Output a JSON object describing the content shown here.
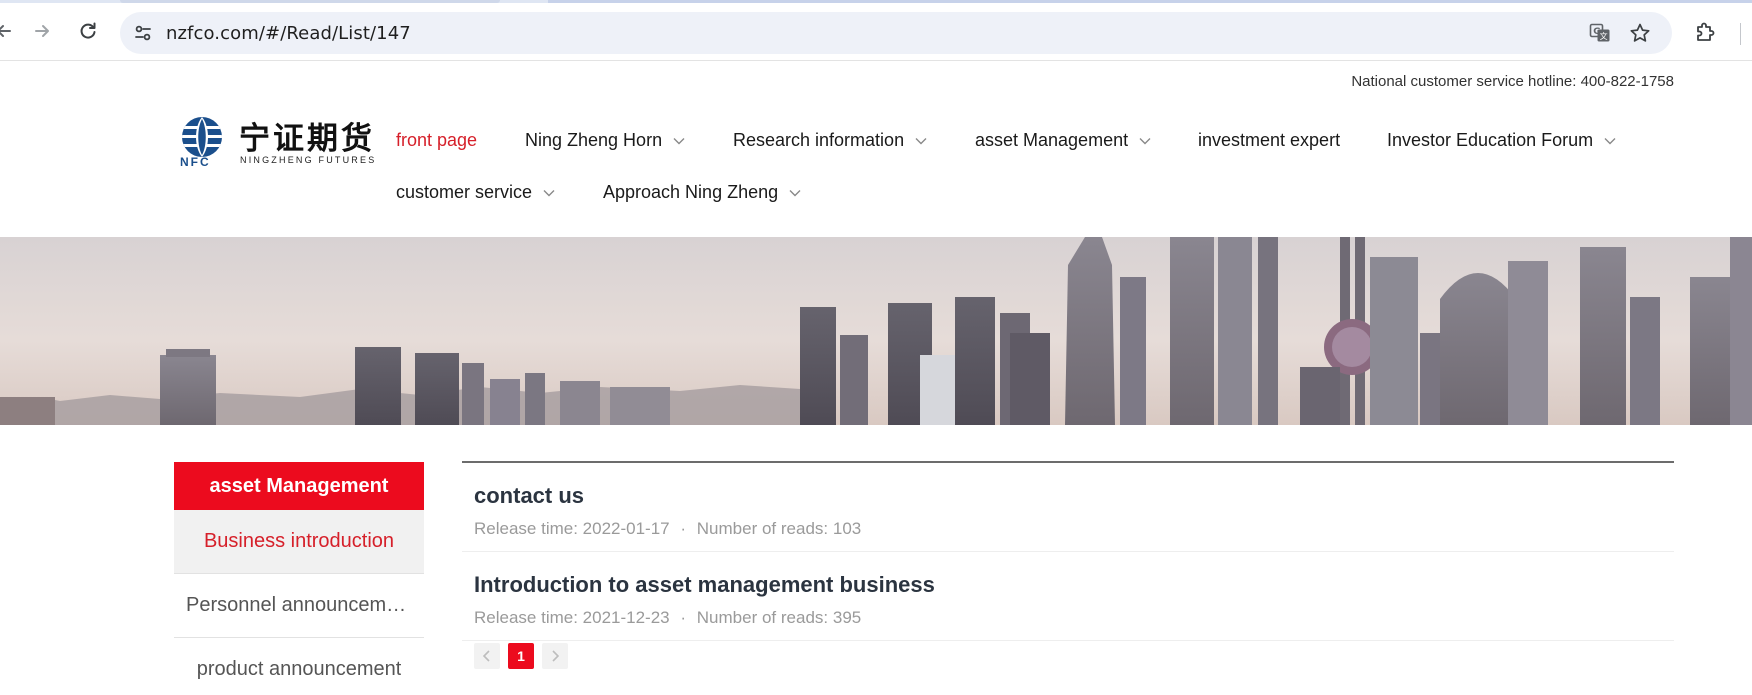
{
  "browser": {
    "url": "nzfco.com/#/Read/List/147",
    "icons": {
      "back": "arrow-left-icon",
      "forward": "arrow-right-icon",
      "reload": "reload-icon",
      "site_info": "tune-icon",
      "translate": "translate-icon",
      "bookmark": "star-icon",
      "extensions": "puzzle-icon"
    }
  },
  "header": {
    "hotline": "National customer service hotline: 400-822-1758",
    "logo": {
      "cn": "宁证期货",
      "en": "NINGZHENG  FUTURES",
      "mark_text": "NFC",
      "brand_color": "#1b4f8c"
    },
    "nav": [
      {
        "label": "front page",
        "active": true,
        "dropdown": false
      },
      {
        "label": "Ning Zheng Horn",
        "active": false,
        "dropdown": true
      },
      {
        "label": "Research information",
        "active": false,
        "dropdown": true
      },
      {
        "label": "asset Management",
        "active": false,
        "dropdown": true
      },
      {
        "label": "investment expert",
        "active": false,
        "dropdown": false
      },
      {
        "label": "Investor Education Forum",
        "active": false,
        "dropdown": true
      },
      {
        "label": "customer service",
        "active": false,
        "dropdown": true
      },
      {
        "label": "Approach Ning Zheng",
        "active": false,
        "dropdown": true
      }
    ]
  },
  "sidebar": {
    "title": "asset Management",
    "items": [
      {
        "label": "Business introduction",
        "active": true
      },
      {
        "label": "Personnel announcement",
        "active": false
      },
      {
        "label": "product announcement",
        "active": false
      }
    ]
  },
  "articles": [
    {
      "title": "contact us",
      "release_label": "Release time:",
      "release_date": "2022-01-17",
      "reads_label": "Number of reads:",
      "reads": "103"
    },
    {
      "title": "Introduction to asset management business",
      "release_label": "Release time:",
      "release_date": "2021-12-23",
      "reads_label": "Number of reads:",
      "reads": "395"
    }
  ],
  "pagination": {
    "current_page": "1",
    "prev_icon": "chevron-left-icon",
    "next_icon": "chevron-right-icon"
  },
  "colors": {
    "accent_red": "#ec0b1e",
    "active_text_red": "#d6202a",
    "title_dark": "#2b3440",
    "meta_gray": "#9a9a9a"
  }
}
